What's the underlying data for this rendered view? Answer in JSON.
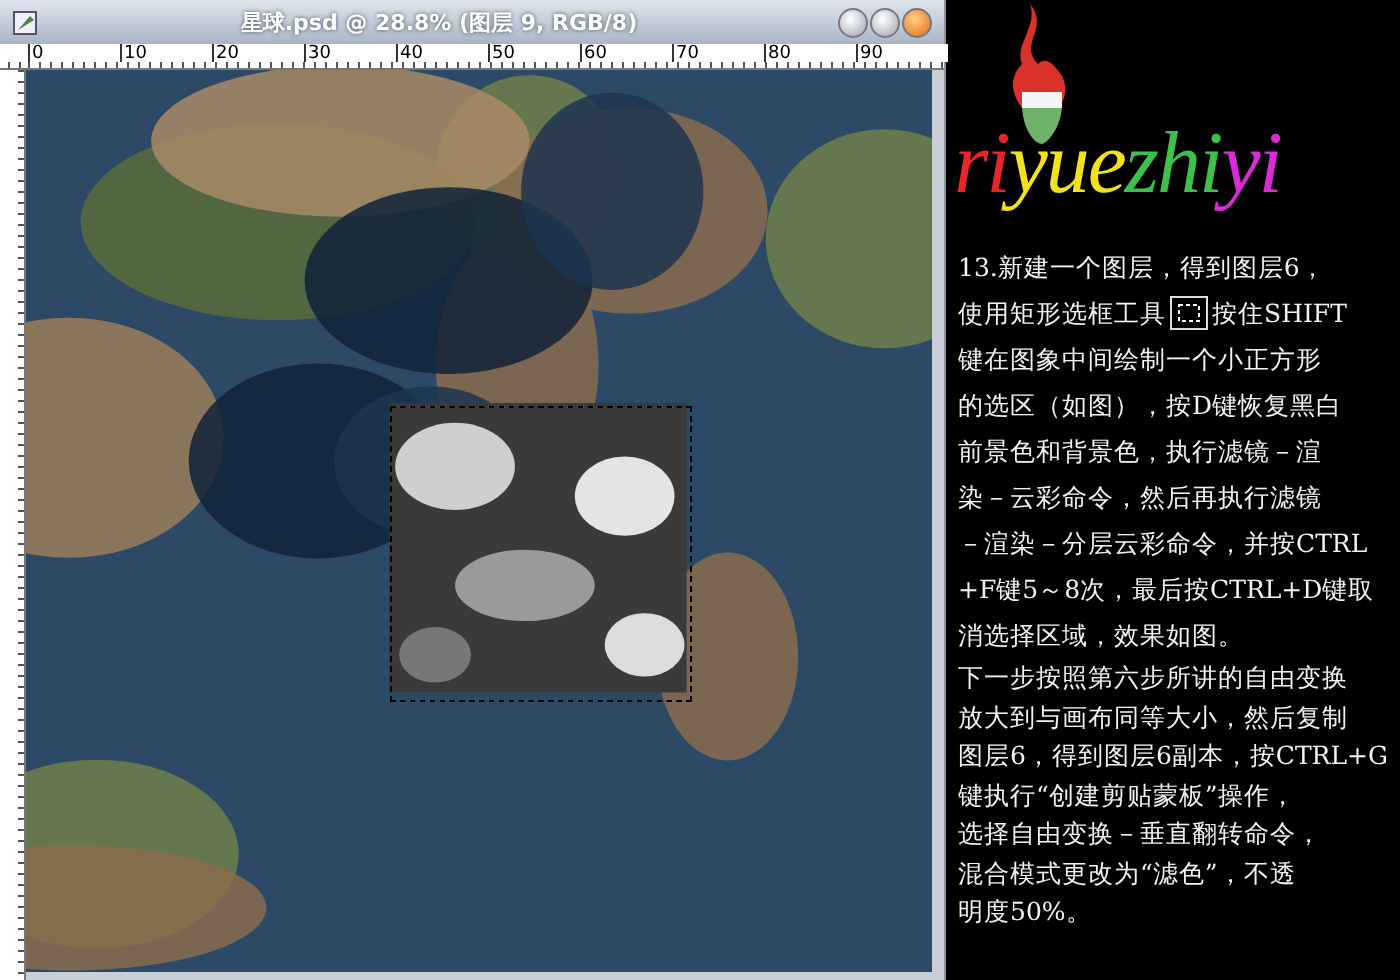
{
  "window": {
    "title": "星球.psd @ 28.8% (图层 9, RGB/8)"
  },
  "ruler": {
    "labels": [
      "0",
      "10",
      "20",
      "30",
      "40",
      "50",
      "60",
      "70",
      "80",
      "90"
    ]
  },
  "logo": [
    {
      "text": "ri",
      "color": "#e8262a"
    },
    {
      "text": "yue",
      "color": "#f2e21c"
    },
    {
      "text": "zhi",
      "color": "#3cc24a"
    },
    {
      "text": "yi",
      "color": "#d92bd6"
    }
  ],
  "instructions": [
    {
      "kind": "text",
      "text": "13.新建一个图层，得到图层6，"
    },
    {
      "kind": "tool",
      "before": "使用矩形选框工具",
      "after": "按住SHIFT"
    },
    {
      "kind": "text",
      "text": "键在图象中间绘制一个小正方形"
    },
    {
      "kind": "text",
      "text": "的选区（如图），按D键恢复黑白"
    },
    {
      "kind": "text",
      "text": "前景色和背景色，执行滤镜－渲"
    },
    {
      "kind": "text",
      "text": "染－云彩命令，然后再执行滤镜"
    },
    {
      "kind": "text",
      "text": "－渲染－分层云彩命令，并按CTRL"
    },
    {
      "kind": "text",
      "text": "+F键5～8次，最后按CTRL+D键取"
    },
    {
      "kind": "text",
      "text": "消选择区域，效果如图。"
    }
  ],
  "next_steps": [
    "下一步按照第六步所讲的自由变换",
    "放大到与画布同等大小，然后复制",
    "图层6，得到图层6副本，按CTRL+G",
    "键执行“创建剪贴蒙板”操作，",
    "选择自由变换－垂直翻转命令，",
    "混合模式更改为“滤色”，不透",
    "明度50%。"
  ]
}
